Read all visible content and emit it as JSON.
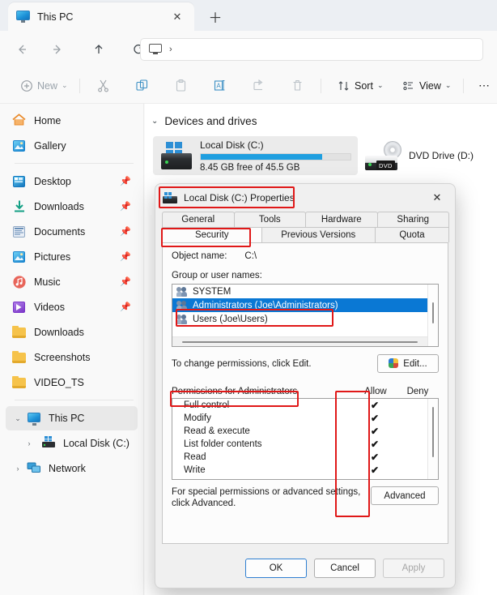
{
  "window": {
    "tab_title": "This PC",
    "tab_icon": "this-pc-icon",
    "close_label": "✕",
    "newtab_label": "＋"
  },
  "nav": {
    "back": "←",
    "forward": "→",
    "up": "↑",
    "refresh": "⟳",
    "address_crumb_icon": "this-pc-icon",
    "address_chevron": "›"
  },
  "toolbar": {
    "new_label": "New",
    "chevron": "⌄",
    "cut": "cut-icon",
    "copy": "copy-icon",
    "paste": "paste-icon",
    "rename": "rename-icon",
    "share": "share-icon",
    "delete": "delete-icon",
    "sort_label": "Sort",
    "view_label": "View",
    "more_label": "⋯"
  },
  "sidebar": {
    "top": [
      {
        "label": "Home",
        "icon": "home-icon"
      },
      {
        "label": "Gallery",
        "icon": "gallery-icon"
      }
    ],
    "quick": [
      {
        "label": "Desktop",
        "icon": "desktop-icon",
        "pinned": true
      },
      {
        "label": "Downloads",
        "icon": "downloads-icon",
        "pinned": true
      },
      {
        "label": "Documents",
        "icon": "documents-icon",
        "pinned": true
      },
      {
        "label": "Pictures",
        "icon": "pictures-icon",
        "pinned": true
      },
      {
        "label": "Music",
        "icon": "music-icon",
        "pinned": true
      },
      {
        "label": "Videos",
        "icon": "videos-icon",
        "pinned": true
      },
      {
        "label": "Downloads",
        "icon": "folder-icon",
        "pinned": false
      },
      {
        "label": "Screenshots",
        "icon": "folder-icon",
        "pinned": false
      },
      {
        "label": "VIDEO_TS",
        "icon": "folder-icon",
        "pinned": false
      }
    ],
    "tree": [
      {
        "label": "This PC",
        "icon": "this-pc-icon",
        "chevron": "⌄",
        "selected": true
      },
      {
        "label": "Local Disk (C:)",
        "icon": "drive-icon",
        "chevron": "›",
        "selected": false
      },
      {
        "label": "Network",
        "icon": "network-icon",
        "chevron": "›",
        "selected": false
      }
    ]
  },
  "content": {
    "group_title": "Devices and drives",
    "group_chevron": "⌄",
    "drives": [
      {
        "name": "Local Disk (C:)",
        "capacity_text": "8.45 GB free of 45.5 GB",
        "used_percent": 81,
        "bar_color": "#1f9fe0"
      }
    ],
    "dvd": {
      "name": "DVD Drive (D:)",
      "tag": "DVD"
    }
  },
  "dialog": {
    "title": "Local Disk (C:) Properties",
    "close_label": "✕",
    "tabs_row1": [
      "General",
      "Tools",
      "Hardware",
      "Sharing"
    ],
    "tabs_row2": [
      "Security",
      "Previous Versions",
      "Quota"
    ],
    "active_tab": "Security",
    "object_name_label": "Object name:",
    "object_name_value": "C:\\",
    "group_label": "Group or user names:",
    "users": [
      {
        "name": "SYSTEM",
        "selected": false
      },
      {
        "name": "Administrators (Joe\\Administrators)",
        "selected": true
      },
      {
        "name": "Users (Joe\\Users)",
        "selected": false
      }
    ],
    "edit_hint": "To change permissions, click Edit.",
    "edit_button": "Edit...",
    "permissions_title": "Permissions for Administrators",
    "col_allow": "Allow",
    "col_deny": "Deny",
    "permissions": [
      {
        "name": "Full control",
        "allow": "✔",
        "deny": ""
      },
      {
        "name": "Modify",
        "allow": "✔",
        "deny": ""
      },
      {
        "name": "Read & execute",
        "allow": "✔",
        "deny": ""
      },
      {
        "name": "List folder contents",
        "allow": "✔",
        "deny": ""
      },
      {
        "name": "Read",
        "allow": "✔",
        "deny": ""
      },
      {
        "name": "Write",
        "allow": "✔",
        "deny": ""
      }
    ],
    "advanced_hint_line1": "For special permissions or advanced settings,",
    "advanced_hint_line2": "click Advanced.",
    "advanced_button": "Advanced",
    "ok_button": "OK",
    "cancel_button": "Cancel",
    "apply_button": "Apply"
  },
  "annotations": {
    "color": "#e01818",
    "boxes": [
      {
        "name": "dialog-title-highlight"
      },
      {
        "name": "security-tab-highlight"
      },
      {
        "name": "administrators-row-highlight"
      },
      {
        "name": "permissions-title-highlight"
      },
      {
        "name": "allow-column-highlight"
      }
    ]
  }
}
